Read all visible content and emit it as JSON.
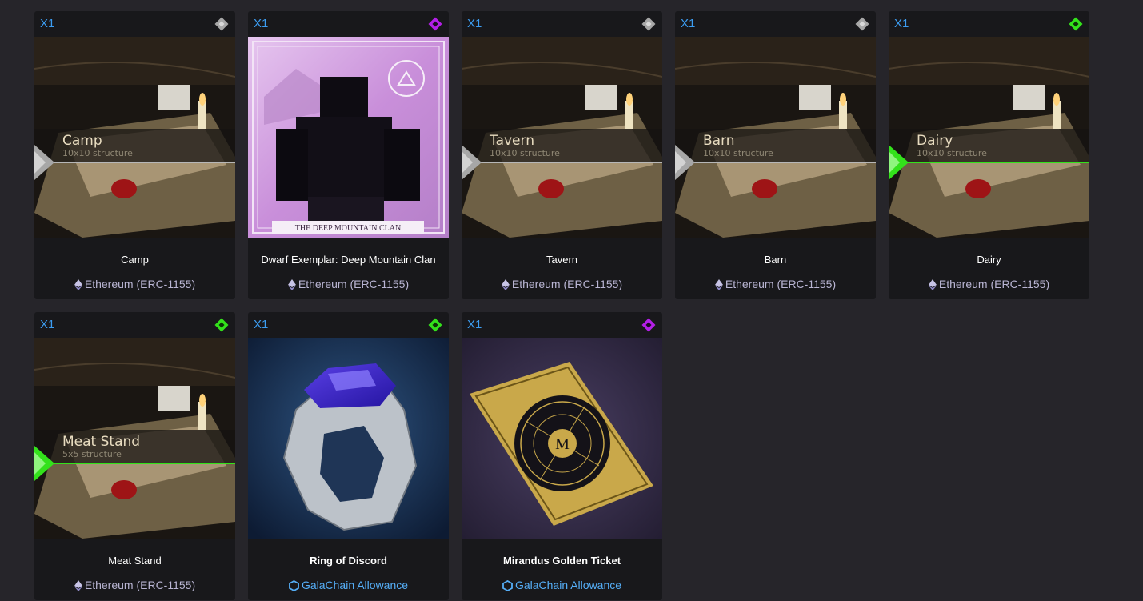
{
  "colors": {
    "background": "#26252a",
    "card": "#18181b",
    "quantity": "#3c9df2",
    "rarity_common": "#a7a7a7",
    "rarity_uncommon": "#33e21b",
    "rarity_epic": "#b41fe8",
    "chain_ethereum": "#b9b5d3",
    "chain_gala": "#55aef7"
  },
  "cards": [
    {
      "qty": "X1",
      "rarity": "common",
      "rarity_icon": "diamond-rarity-icon",
      "image": "structure-art",
      "overlay_title": "Camp",
      "overlay_subtitle": "10x10 structure",
      "name": "Camp",
      "chain": "Ethereum (ERC-1155)",
      "chain_icon": "ethereum-icon"
    },
    {
      "qty": "X1",
      "rarity": "epic",
      "rarity_icon": "diamond-rarity-icon",
      "image": "dwarf-exemplar-art",
      "banner": "THE DEEP MOUNTAIN CLAN",
      "name": "Dwarf Exemplar: Deep Mountain Clan",
      "chain": "Ethereum (ERC-1155)",
      "chain_icon": "ethereum-icon"
    },
    {
      "qty": "X1",
      "rarity": "common",
      "rarity_icon": "diamond-rarity-icon",
      "image": "structure-art",
      "overlay_title": "Tavern",
      "overlay_subtitle": "10x10 structure",
      "name": "Tavern",
      "chain": "Ethereum (ERC-1155)",
      "chain_icon": "ethereum-icon"
    },
    {
      "qty": "X1",
      "rarity": "common",
      "rarity_icon": "diamond-rarity-icon",
      "image": "structure-art",
      "overlay_title": "Barn",
      "overlay_subtitle": "10x10 structure",
      "name": "Barn",
      "chain": "Ethereum (ERC-1155)",
      "chain_icon": "ethereum-icon"
    },
    {
      "qty": "X1",
      "rarity": "uncommon",
      "rarity_icon": "diamond-rarity-icon",
      "image": "structure-art",
      "overlay_title": "Dairy",
      "overlay_subtitle": "10x10 structure",
      "name": "Dairy",
      "chain": "Ethereum (ERC-1155)",
      "chain_icon": "ethereum-icon"
    },
    {
      "qty": "X1",
      "rarity": "uncommon",
      "rarity_icon": "diamond-rarity-icon",
      "image": "structure-art",
      "overlay_title": "Meat Stand",
      "overlay_subtitle": "5x5 structure",
      "name": "Meat Stand",
      "chain": "Ethereum (ERC-1155)",
      "chain_icon": "ethereum-icon"
    },
    {
      "qty": "X1",
      "rarity": "uncommon",
      "rarity_icon": "diamond-rarity-icon",
      "image": "ring-art",
      "name": "Ring of Discord",
      "chain": "GalaChain Allowance",
      "chain_icon": "galachain-hexagon-icon"
    },
    {
      "qty": "X1",
      "rarity": "epic",
      "rarity_icon": "diamond-rarity-icon",
      "image": "golden-ticket-art",
      "ticket_letter": "M",
      "name": "Mirandus Golden Ticket",
      "chain": "GalaChain Allowance",
      "chain_icon": "galachain-hexagon-icon"
    }
  ]
}
